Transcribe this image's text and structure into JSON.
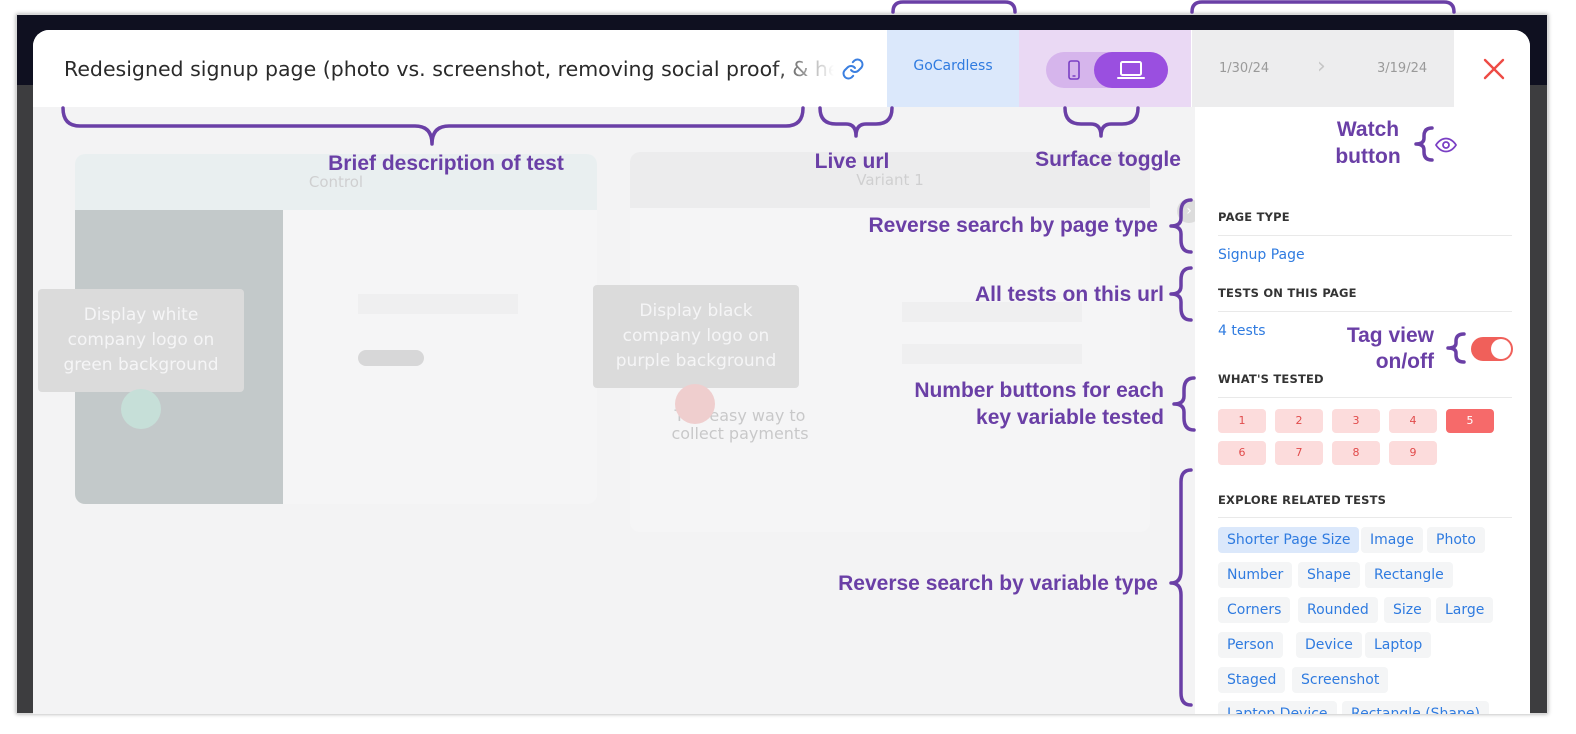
{
  "header": {
    "title": "Redesigned signup page (photo vs. screenshot, removing social proof, & headline)",
    "company": "GoCardless",
    "date_start": "1/30/24",
    "date_end": "3/19/24",
    "date_arrow": "›"
  },
  "preview": {
    "control_label": "Control",
    "variant_label": "Variant 1",
    "control_note": "Display white company logo on green background",
    "variant_note": "Display black company logo on purple background",
    "variant_headline": "The easy way to collect payments",
    "scroll_glyph": "›"
  },
  "panel": {
    "page_type_label": "PAGE TYPE",
    "page_type_value": "Signup Page",
    "tests_label": "TESTS ON THIS PAGE",
    "tests_value": "4 tests",
    "whats_tested_label": "WHAT'S TESTED",
    "tag_view_on": true,
    "numbers": [
      "1",
      "2",
      "3",
      "4",
      "5",
      "6",
      "7",
      "8",
      "9"
    ],
    "active_number": "5",
    "explore_label": "EXPLORE RELATED TESTS",
    "tags": [
      "Shorter Page Size",
      "Image",
      "Photo",
      "Number",
      "Shape",
      "Rectangle",
      "Corners",
      "Rounded",
      "Size",
      "Large",
      "Person",
      "Device",
      "Laptop",
      "Staged",
      "Screenshot",
      "Laptop Device",
      "Rectangle (Shape)"
    ]
  },
  "annotations": {
    "brief": "Brief description of test",
    "live_url": "Live url",
    "surface_toggle": "Surface toggle",
    "watch_line1": "Watch",
    "watch_line2": "button",
    "page_type": "Reverse search by page type",
    "all_tests": "All tests on this url",
    "tag_view_line1": "Tag view",
    "tag_view_line2": "on/off",
    "number_line1": "Number buttons for each",
    "number_line2": "key variable tested",
    "variable_type": "Reverse search by variable type"
  },
  "colors": {
    "annotation": "#6a3fa6",
    "accent_blue": "#2f7be0",
    "toggle_purple": "#9a4fe0",
    "danger_red": "#f0605a"
  }
}
